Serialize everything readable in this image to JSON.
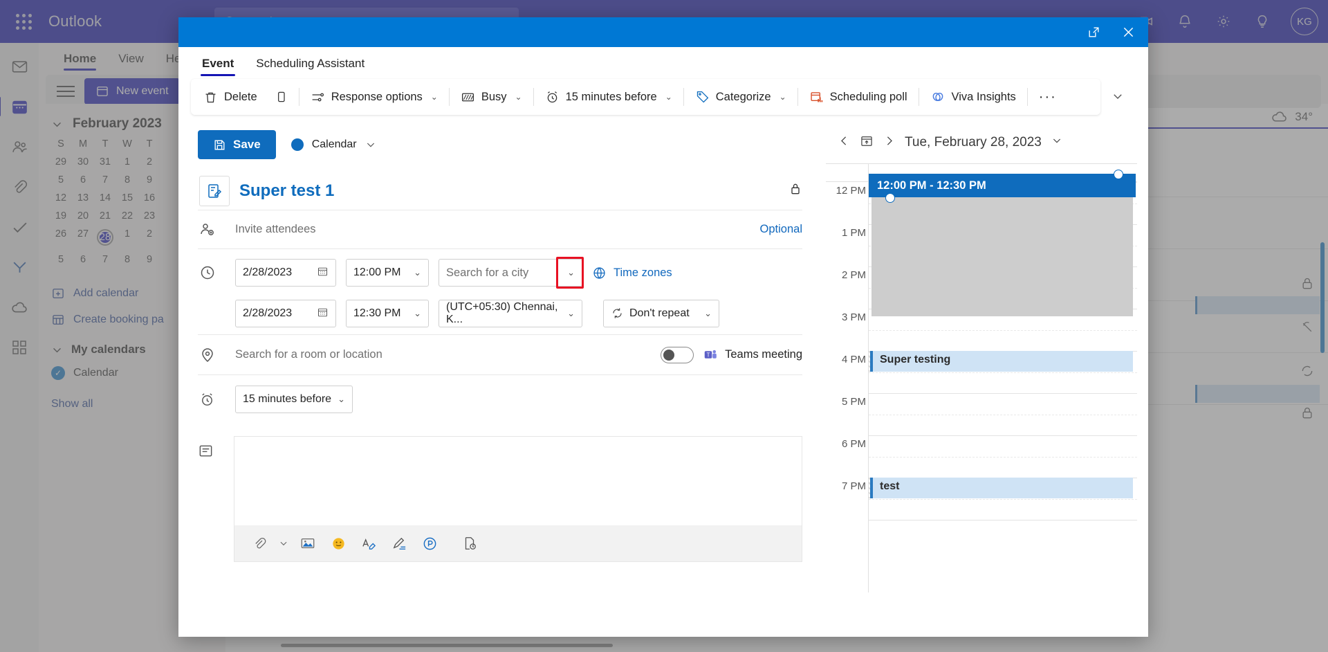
{
  "suite": {
    "app_name": "Outlook",
    "search_placeholder": "Search",
    "icons": {
      "waffle": "app-launcher-icon",
      "search": "search-icon",
      "bell": "notifications-icon",
      "gear": "settings-icon",
      "bulb": "tips-icon"
    },
    "avatar_initials": "KG"
  },
  "ribbon": {
    "tabs": [
      {
        "label": "Home",
        "active": true
      },
      {
        "label": "View",
        "active": false
      },
      {
        "label": "Help",
        "active": false
      }
    ],
    "new_event_label": "New event"
  },
  "left_pane": {
    "month_title": "February 2023",
    "dow": [
      "S",
      "M",
      "T",
      "W",
      "T"
    ],
    "weeks": [
      [
        "29",
        "30",
        "31",
        "1",
        "2"
      ],
      [
        "5",
        "6",
        "7",
        "8",
        "9"
      ],
      [
        "12",
        "13",
        "14",
        "15",
        "16"
      ],
      [
        "19",
        "20",
        "21",
        "22",
        "23"
      ],
      [
        "26",
        "27",
        "28",
        "1",
        "2"
      ],
      [
        "5",
        "6",
        "7",
        "8",
        "9"
      ]
    ],
    "today": "28",
    "add_calendar": "Add calendar",
    "create_booking": "Create booking pa",
    "my_calendars": "My calendars",
    "calendar_item": "Calendar",
    "show_all": "Show all"
  },
  "background_calendar": {
    "weather_temp": "34°",
    "weather_icon": "cloud-icon"
  },
  "dialog": {
    "titlebar": {
      "popout": "popout-icon",
      "close": "close-icon"
    },
    "tabs": [
      {
        "label": "Event",
        "active": true
      },
      {
        "label": "Scheduling Assistant",
        "active": false
      }
    ],
    "toolbar": [
      {
        "label": "Delete",
        "icon": "trash-icon",
        "chevron": false
      },
      {
        "label": "",
        "icon": "copy-icon",
        "chevron": false
      },
      {
        "label": "Response options",
        "icon": "sliders-icon",
        "chevron": true
      },
      {
        "label": "Busy",
        "icon": "busy-icon",
        "chevron": true
      },
      {
        "label": "15 minutes before",
        "icon": "alarm-icon",
        "chevron": true
      },
      {
        "label": "Categorize",
        "icon": "tag-icon",
        "chevron": true
      },
      {
        "label": "Scheduling poll",
        "icon": "poll-icon",
        "chevron": false
      },
      {
        "label": "Viva Insights",
        "icon": "viva-icon",
        "chevron": false
      },
      {
        "label": "···",
        "icon": "more-icon",
        "chevron": false
      }
    ],
    "form": {
      "save_label": "Save",
      "calendar_label": "Calendar",
      "calendar_color": "#0f6cbd",
      "event_title": "Super test 1",
      "attendees_placeholder": "Invite attendees",
      "optional_label": "Optional",
      "start_date": "2/28/2023",
      "start_time": "12:00 PM",
      "start_timezone_placeholder": "Search for a city",
      "time_zones_link": "Time zones",
      "end_date": "2/28/2023",
      "end_time": "12:30 PM",
      "end_timezone": "(UTC+05:30) Chennai, K...",
      "repeat_label": "Don't repeat",
      "location_placeholder": "Search for a room or location",
      "teams_meeting_label": "Teams meeting",
      "teams_toggle_on": false,
      "reminder_label": "15 minutes before",
      "editor_tools": [
        "attach-icon",
        "image-icon",
        "emoji-icon",
        "signature-icon",
        "draw-icon",
        "dictate-icon",
        "insert-file-icon"
      ]
    },
    "preview": {
      "date_label": "Tue, February 28, 2023",
      "prev_icon": "chevron-left-icon",
      "today_icon": "today-icon",
      "next_icon": "chevron-right-icon",
      "new_event_chip": "12:00 PM - 12:30 PM",
      "hours": [
        "12 PM",
        "1 PM",
        "2 PM",
        "3 PM",
        "4 PM",
        "5 PM",
        "6 PM",
        "7 PM"
      ],
      "events": [
        {
          "title": "Super testing",
          "hour_index": 4
        },
        {
          "title": "test",
          "hour_index": 7
        }
      ]
    }
  },
  "highlight": {
    "color": "#e81123",
    "target": "start-timezone-dropdown"
  }
}
